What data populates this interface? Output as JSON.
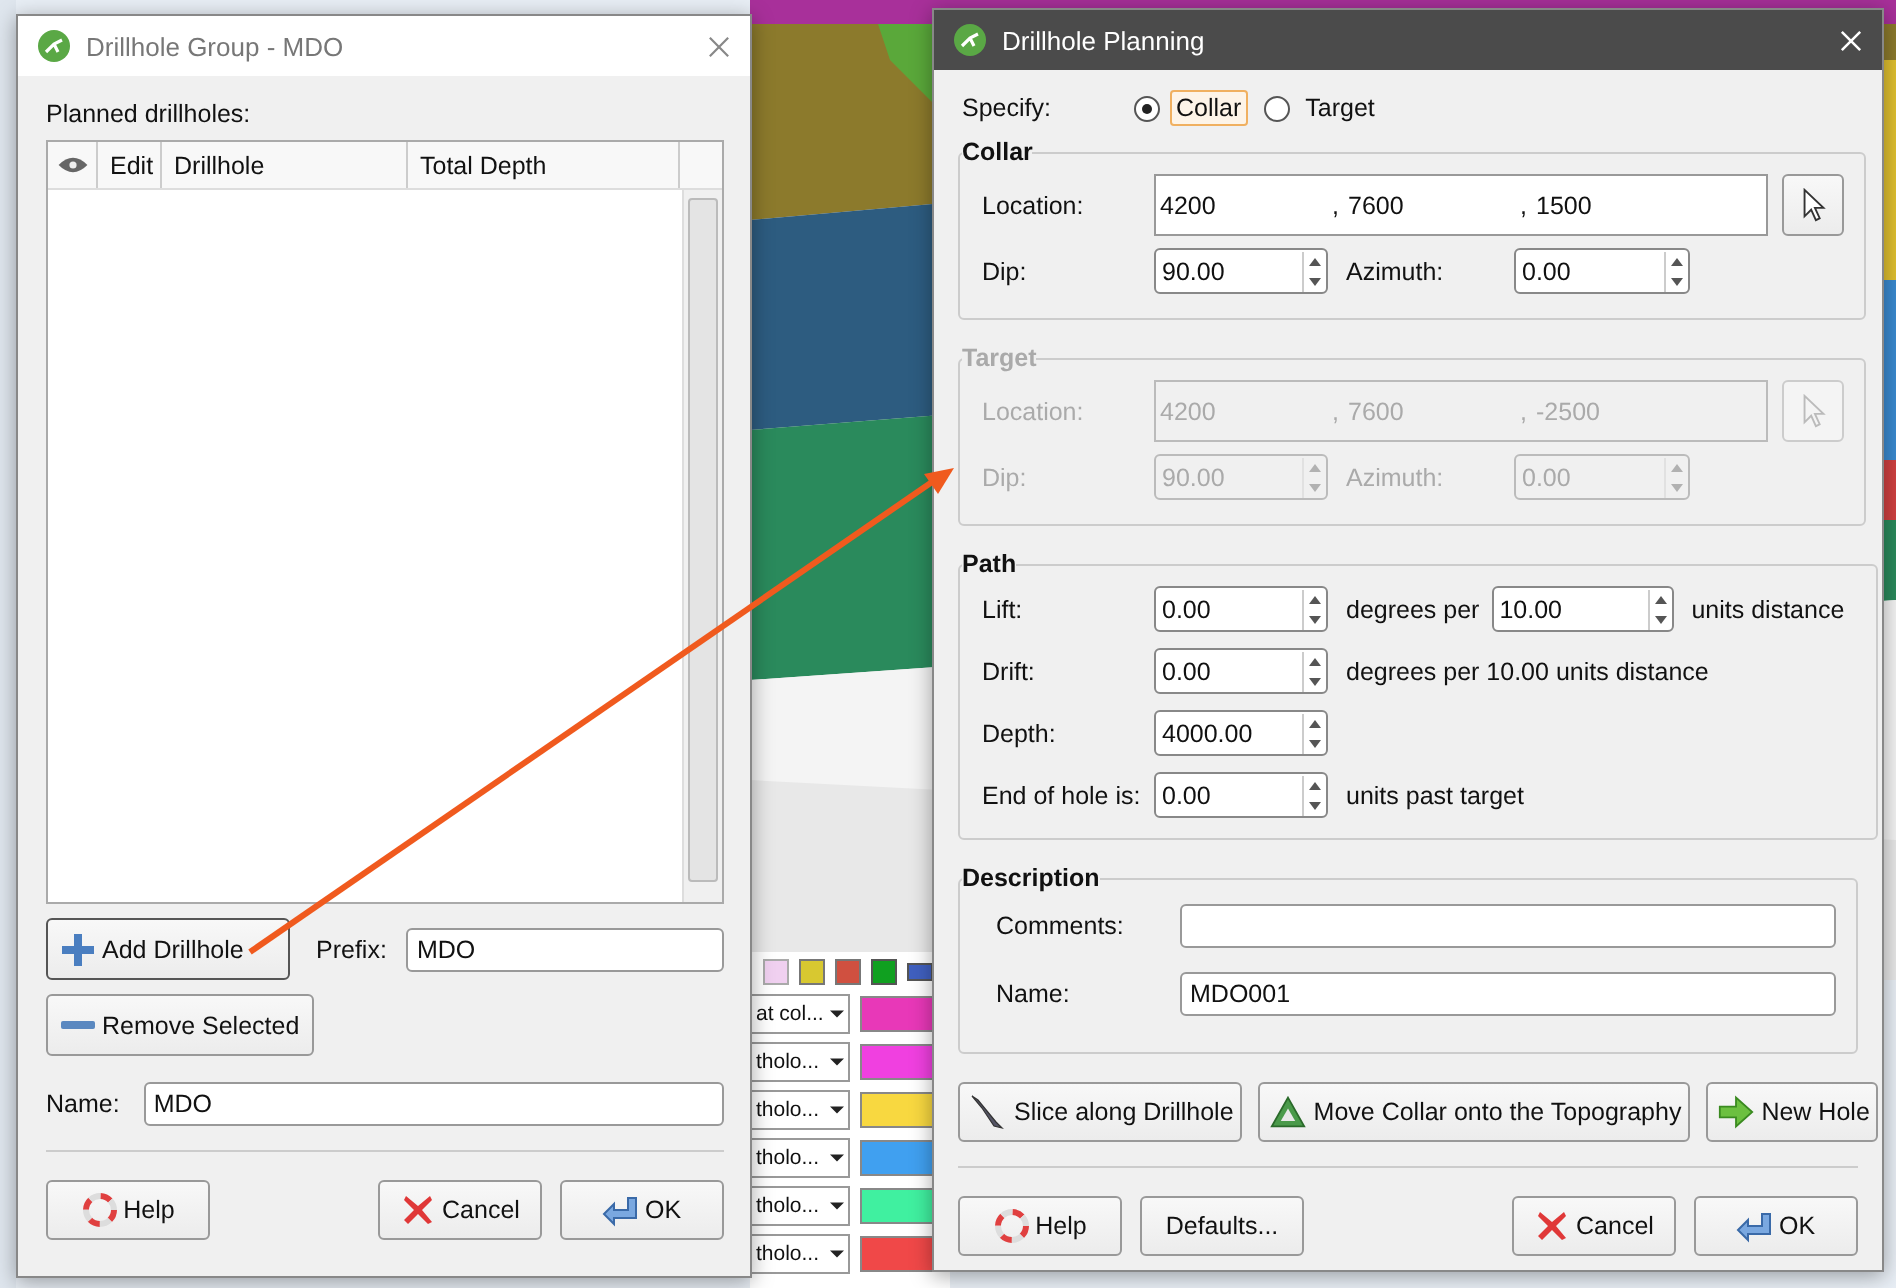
{
  "background": {
    "rows": [
      {
        "value": "at col...",
        "color": "#e838b8"
      },
      {
        "value": "tholo...",
        "color": "#f040e0"
      },
      {
        "value": "tholo...",
        "color": "#f8d840"
      },
      {
        "value": "tholo...",
        "color": "#40a0f0"
      },
      {
        "value": "tholo...",
        "color": "#40f0a0"
      },
      {
        "value": "tholo...",
        "color": "#f04848"
      }
    ]
  },
  "group_dialog": {
    "title": "Drillhole Group - MDO",
    "list_label": "Planned drillholes:",
    "columns": [
      "Edit",
      "Drillhole",
      "Total Depth"
    ],
    "add_button": "Add Drillhole",
    "prefix_label": "Prefix:",
    "prefix_value": "MDO",
    "remove_button": "Remove Selected",
    "name_label": "Name:",
    "name_value": "MDO",
    "buttons": [
      {
        "kind": "help",
        "label": "Help"
      },
      {
        "kind": "cancel",
        "label": "Cancel"
      },
      {
        "kind": "ok",
        "label": "OK"
      }
    ]
  },
  "planning_dialog": {
    "title": "Drillhole Planning",
    "specify_label": "Specify:",
    "specify_options": [
      {
        "label": "Collar",
        "selected": true
      },
      {
        "label": "Target",
        "selected": false
      }
    ],
    "groups": [
      {
        "title": "Collar",
        "disabled": false,
        "location_label": "Location:",
        "location": [
          {
            "kind": "value",
            "text": "4200"
          },
          {
            "kind": "separator",
            "text": ","
          },
          {
            "kind": "value",
            "text": "7600"
          },
          {
            "kind": "separator",
            "text": ","
          },
          {
            "kind": "value",
            "text": "1500"
          }
        ],
        "dip_label": "Dip:",
        "dip": "90.00",
        "azimuth_label": "Azimuth:",
        "azimuth": "0.00"
      },
      {
        "title": "Target",
        "disabled": true,
        "location_label": "Location:",
        "location": [
          {
            "kind": "value",
            "text": "4200"
          },
          {
            "kind": "separator",
            "text": ","
          },
          {
            "kind": "value",
            "text": "7600"
          },
          {
            "kind": "separator",
            "text": ","
          },
          {
            "kind": "value",
            "text": "-2500"
          }
        ],
        "dip_label": "Dip:",
        "dip": "90.00",
        "azimuth_label": "Azimuth:",
        "azimuth": "0.00"
      }
    ],
    "path": {
      "title": "Path",
      "rows": [
        {
          "label": "Lift:",
          "parts": [
            {
              "kind": "spin",
              "text": "0.00"
            },
            {
              "kind": "text",
              "text": "degrees per"
            },
            {
              "kind": "spin",
              "text": "10.00"
            },
            {
              "kind": "text",
              "text": "units distance"
            }
          ]
        },
        {
          "label": "Drift:",
          "parts": [
            {
              "kind": "spin",
              "text": "0.00"
            },
            {
              "kind": "text",
              "text": "degrees per 10.00 units distance"
            }
          ]
        },
        {
          "label": "Depth:",
          "parts": [
            {
              "kind": "spin",
              "text": "4000.00"
            }
          ]
        },
        {
          "label": "End of hole is:",
          "parts": [
            {
              "kind": "spin",
              "text": "0.00"
            },
            {
              "kind": "text",
              "text": "units past target"
            }
          ]
        }
      ]
    },
    "description": {
      "title": "Description",
      "comments_label": "Comments:",
      "name_label": "Name:",
      "name_value": "MDO001"
    },
    "actions": [
      {
        "kind": "slice",
        "label": "Slice along Drillhole"
      },
      {
        "kind": "topography",
        "label": "Move Collar onto the Topography"
      },
      {
        "kind": "new",
        "label": "New Hole"
      }
    ],
    "buttons": [
      {
        "kind": "help",
        "label": "Help"
      },
      {
        "kind": "defaults",
        "label": "Defaults..."
      },
      {
        "kind": "cancel",
        "label": "Cancel"
      },
      {
        "kind": "ok",
        "label": "OK"
      }
    ]
  }
}
